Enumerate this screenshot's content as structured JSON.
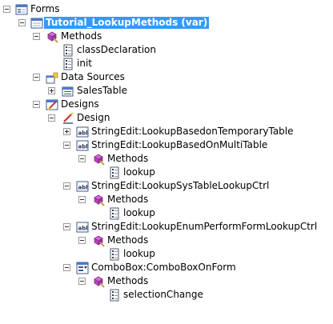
{
  "tree": {
    "root": {
      "label": "Forms",
      "icon": "forms-icon"
    },
    "form": {
      "label": "Tutorial_LookupMethods",
      "suffix": "(var)",
      "icon": "form-icon"
    },
    "methods": {
      "label": "Methods",
      "icon": "methods-icon",
      "items": [
        {
          "label": "classDeclaration",
          "icon": "method-icon"
        },
        {
          "label": "init",
          "icon": "method-icon"
        }
      ]
    },
    "data_sources": {
      "label": "Data Sources",
      "icon": "datasources-icon",
      "items": [
        {
          "label": "SalesTable",
          "icon": "table-icon"
        }
      ]
    },
    "designs": {
      "label": "Designs",
      "icon": "designs-icon"
    },
    "design": {
      "label": "Design",
      "icon": "design-icon"
    },
    "controls": [
      {
        "label": "StringEdit:LookupBasedonTemporaryTable",
        "icon": "stringedit-icon",
        "expanded": false
      },
      {
        "label": "StringEdit:LookupBasedOnMultiTable",
        "icon": "stringedit-icon",
        "expanded": true,
        "methods_label": "Methods",
        "method": "lookup"
      },
      {
        "label": "StringEdit:LookupSysTableLookupCtrl",
        "icon": "stringedit-icon",
        "expanded": true,
        "methods_label": "Methods",
        "method": "lookup"
      },
      {
        "label": "StringEdit:LookupEnumPerformFormLookupCtrl",
        "icon": "stringedit-icon",
        "expanded": true,
        "methods_label": "Methods",
        "method": "lookup"
      },
      {
        "label": "ComboBox:ComboBoxOnForm",
        "icon": "combobox-icon",
        "expanded": true,
        "methods_label": "Methods",
        "method": "selectionChange"
      }
    ]
  },
  "colors": {
    "selection": "#3399ff",
    "selection_text": "#ffffff"
  }
}
